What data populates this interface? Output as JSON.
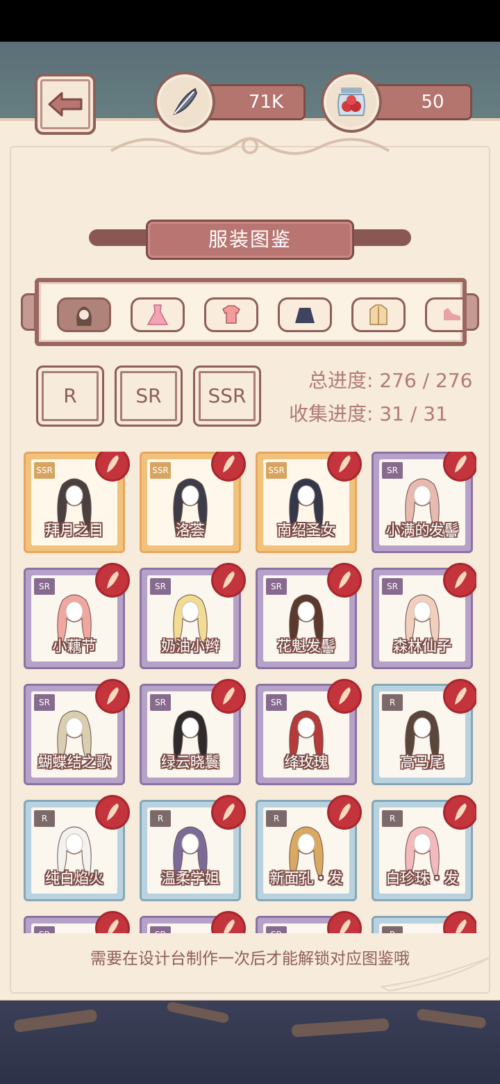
{
  "header": {
    "back_icon": "back-arrow-icon",
    "currency_feather": {
      "value": "71K",
      "icon": "quill-feather-icon"
    },
    "currency_berries": {
      "value": "50",
      "icon": "berry-jar-icon"
    }
  },
  "title": "服装图鉴",
  "categories": [
    {
      "name": "hair",
      "icon": "hair-icon",
      "active": true
    },
    {
      "name": "dress",
      "icon": "dress-icon",
      "active": false
    },
    {
      "name": "top",
      "icon": "top-icon",
      "active": false
    },
    {
      "name": "skirt",
      "icon": "skirt-icon",
      "active": false
    },
    {
      "name": "jacket",
      "icon": "jacket-icon",
      "active": false
    },
    {
      "name": "shoes",
      "icon": "shoes-icon",
      "active": false
    }
  ],
  "rarity_filters": [
    "R",
    "SR",
    "SSR"
  ],
  "progress": {
    "total_label": "总进度: 276 / 276",
    "collect_label": "收集进度: 31 / 31"
  },
  "items": [
    {
      "rarity": "SSR",
      "name": "拜月之目",
      "hair_color": "#4a4040"
    },
    {
      "rarity": "SSR",
      "name": "洛荟",
      "hair_color": "#3d3d4a"
    },
    {
      "rarity": "SSR",
      "name": "南绍圣女",
      "hair_color": "#33384a"
    },
    {
      "rarity": "SR",
      "name": "小满的发髻",
      "hair_color": "#e8b9ae"
    },
    {
      "rarity": "SR",
      "name": "小藕节",
      "hair_color": "#f0a7a0"
    },
    {
      "rarity": "SR",
      "name": "奶油小辫",
      "hair_color": "#f2dc93"
    },
    {
      "rarity": "SR",
      "name": "花魁发髻",
      "hair_color": "#5a3a2e"
    },
    {
      "rarity": "SR",
      "name": "森林仙子",
      "hair_color": "#f1cfbd"
    },
    {
      "rarity": "SR",
      "name": "蝴蝶结之歌",
      "hair_color": "#d9cfb0"
    },
    {
      "rarity": "SR",
      "name": "绿云晓鬟",
      "hair_color": "#2d2b2b"
    },
    {
      "rarity": "SR",
      "name": "绛玫瑰",
      "hair_color": "#b53a3a"
    },
    {
      "rarity": "R",
      "name": "高马尾",
      "hair_color": "#5a463b"
    },
    {
      "rarity": "R",
      "name": "纯白焰火",
      "hair_color": "#f4f2ee"
    },
    {
      "rarity": "R",
      "name": "温柔学姐",
      "hair_color": "#7b6b98"
    },
    {
      "rarity": "R",
      "name": "新面孔・发",
      "hair_color": "#d9a960"
    },
    {
      "rarity": "R",
      "name": "白珍珠・发",
      "hair_color": "#f3b9bd"
    },
    {
      "rarity": "SR",
      "name": "",
      "hair_color": "#333333"
    },
    {
      "rarity": "SR",
      "name": "",
      "hair_color": "#333333"
    },
    {
      "rarity": "SR",
      "name": "",
      "hair_color": "#e8d08a"
    },
    {
      "rarity": "R",
      "name": "",
      "hair_color": "#555555"
    }
  ],
  "hint": "需要在设计台制作一次后才能解锁对应图鉴哦"
}
